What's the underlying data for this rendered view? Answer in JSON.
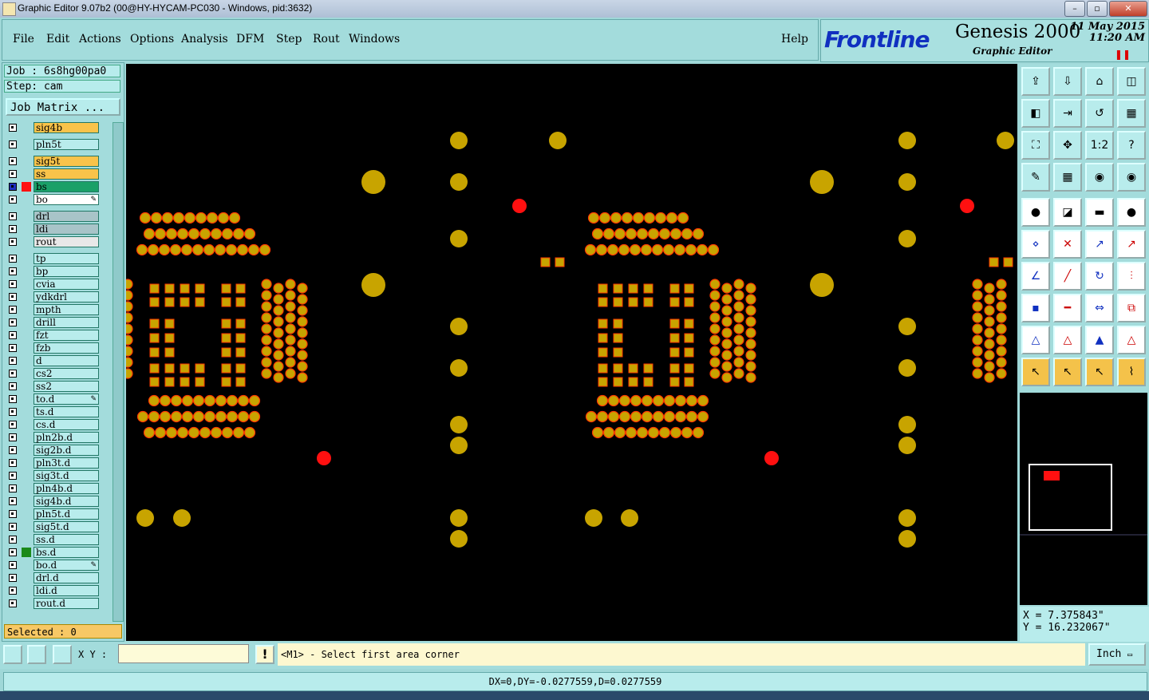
{
  "window": {
    "title": "Graphic Editor 9.07b2 (00@HY-HYCAM-PC030 - Windows, pid:3632)"
  },
  "menu": {
    "items": [
      "File",
      "Edit",
      "Actions",
      "Options",
      "Analysis",
      "DFM",
      "Step",
      "Rout",
      "Windows"
    ],
    "help": "Help"
  },
  "brand": {
    "logo": "Frontline",
    "product": "Genesis 2000",
    "subtitle": "Graphic Editor",
    "date": "11 May 2015",
    "time": "11:20 AM"
  },
  "job": {
    "job_label": "Job  :  6s8hg00pa0",
    "step_label": "Step: cam",
    "matrix_button": "Job Matrix ..."
  },
  "layers": [
    {
      "name": "sig4b",
      "color": "#f9c34a",
      "gap": false
    },
    {
      "name": "pln5t",
      "color": "#b8ecec",
      "gap": true
    },
    {
      "name": "sig5t",
      "color": "#f9c34a",
      "gap": true
    },
    {
      "name": "ss",
      "color": "#f9c34a",
      "gap": false
    },
    {
      "name": "bs",
      "color": "#1aa068",
      "gap": false,
      "active": true
    },
    {
      "name": "bo",
      "color": "#ffffff",
      "gap": false,
      "mark": "✎"
    },
    {
      "name": "drl",
      "color": "#a8c4c8",
      "gap": true
    },
    {
      "name": "ldi",
      "color": "#a8c4c8",
      "gap": false
    },
    {
      "name": "rout",
      "color": "#e8e8e8",
      "gap": false
    },
    {
      "name": "tp",
      "color": "#b8ecec",
      "gap": true
    },
    {
      "name": "bp",
      "color": "#b8ecec",
      "gap": false
    },
    {
      "name": "cvia",
      "color": "#b8ecec",
      "gap": false
    },
    {
      "name": "ydkdrl",
      "color": "#b8ecec",
      "gap": false
    },
    {
      "name": "mpth",
      "color": "#b8ecec",
      "gap": false
    },
    {
      "name": "drill",
      "color": "#b8ecec",
      "gap": false
    },
    {
      "name": "fzt",
      "color": "#b8ecec",
      "gap": false
    },
    {
      "name": "fzb",
      "color": "#b8ecec",
      "gap": false
    },
    {
      "name": "d",
      "color": "#b8ecec",
      "gap": false
    },
    {
      "name": "cs2",
      "color": "#b8ecec",
      "gap": false
    },
    {
      "name": "ss2",
      "color": "#b8ecec",
      "gap": false
    },
    {
      "name": "to.d",
      "color": "#b8ecec",
      "gap": false,
      "mark": "✎"
    },
    {
      "name": "ts.d",
      "color": "#b8ecec",
      "gap": false
    },
    {
      "name": "cs.d",
      "color": "#b8ecec",
      "gap": false
    },
    {
      "name": "pln2b.d",
      "color": "#b8ecec",
      "gap": false
    },
    {
      "name": "sig2b.d",
      "color": "#b8ecec",
      "gap": false
    },
    {
      "name": "pln3t.d",
      "color": "#b8ecec",
      "gap": false
    },
    {
      "name": "sig3t.d",
      "color": "#b8ecec",
      "gap": false
    },
    {
      "name": "pln4b.d",
      "color": "#b8ecec",
      "gap": false
    },
    {
      "name": "sig4b.d",
      "color": "#b8ecec",
      "gap": false
    },
    {
      "name": "pln5t.d",
      "color": "#b8ecec",
      "gap": false
    },
    {
      "name": "sig5t.d",
      "color": "#b8ecec",
      "gap": false
    },
    {
      "name": "ss.d",
      "color": "#b8ecec",
      "gap": false
    },
    {
      "name": "bs.d",
      "color": "#b8ecec",
      "gap": false,
      "swatch": "#1a8a1a"
    },
    {
      "name": "bo.d",
      "color": "#b8ecec",
      "gap": false,
      "mark": "✎"
    },
    {
      "name": "drl.d",
      "color": "#b8ecec",
      "gap": false
    },
    {
      "name": "ldi.d",
      "color": "#b8ecec",
      "gap": false
    },
    {
      "name": "rout.d",
      "color": "#b8ecec",
      "gap": false
    }
  ],
  "selection": {
    "label": "Selected : 0"
  },
  "coords": {
    "x": "X  =  7.375843\"",
    "y": "Y  =  16.232067\""
  },
  "command": {
    "xy_label": "X Y :",
    "xy_value": "",
    "message": "<M1> - Select first area corner",
    "units": "Inch"
  },
  "status": {
    "text": "DX=0,DY=-0.0277559,D=0.0277559"
  },
  "colors": {
    "pad": "#c8a400",
    "pad_outline": "#ff3a00",
    "fiducial": "#ff1010",
    "canvas": "#000000",
    "panel": "#a3dcdc"
  },
  "toolbar_icons": [
    "open-icon",
    "save-icon",
    "home-icon",
    "window-icon",
    "zoom-prev-icon",
    "zoom-next-icon",
    "zoom-back-icon",
    "grid-snap-icon",
    "zoom-fit-icon",
    "pan-icon",
    "ratio-icon",
    "help-icon",
    "brush-icon",
    "grid-icon",
    "layer-red-icon",
    "layer-red2-icon",
    "circle-edit-icon",
    "drawing-icon",
    "ruler-icon",
    "dot-icon",
    "connect-icon",
    "x-select-icon",
    "line-red-icon",
    "line-red2-icon",
    "angle-icon",
    "slash-icon",
    "rotate-icon",
    "ff-icon",
    "pad-add-icon",
    "dash-icon",
    "resize-icon",
    "copy-icon",
    "triangle-icon",
    "triangle2-icon",
    "triangle3-icon",
    "triangle4-icon",
    "pointer-icon",
    "pointer-box-icon",
    "pointer-circle-icon",
    "route-icon"
  ]
}
